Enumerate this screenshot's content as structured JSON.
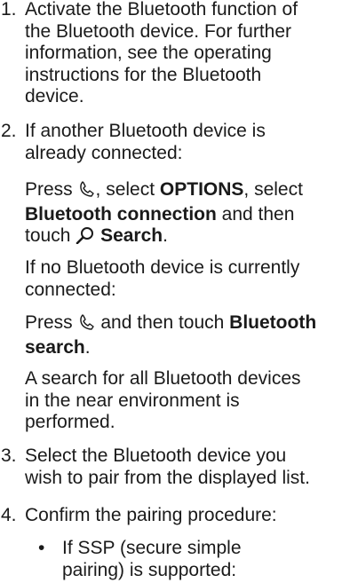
{
  "steps": [
    {
      "number": "1.",
      "lines": [
        "Activate the Bluetooth function of",
        "the Bluetooth device. For further",
        "information, see the operating",
        "instructions for the Bluetooth",
        "device."
      ]
    },
    {
      "number": "2.",
      "lines": [
        "If another Bluetooth device is",
        "already connected:"
      ]
    },
    {
      "number": "3.",
      "lines": [
        "Select the Bluetooth device you",
        "wish to pair from the displayed list."
      ]
    },
    {
      "number": "4.",
      "lines": [
        "Confirm the pairing procedure:"
      ]
    }
  ],
  "para_a": {
    "press": "Press",
    "select": ", select",
    "options": "OPTIONS",
    "select2": ", select",
    "bt_connection": "Bluetooth connection",
    "and_then": "and then",
    "touch": "touch",
    "search": "Search",
    "period": "."
  },
  "para_b": {
    "line1": "If no Bluetooth device is currently",
    "line2": "connected:"
  },
  "para_c": {
    "press": "Press",
    "and_then_touch": "and then touch",
    "bt": "Bluetooth",
    "search": "search",
    "period": "."
  },
  "para_d": {
    "line1": "A search for all Bluetooth devices",
    "line2": "in the near environment is",
    "line3": "performed."
  },
  "bullet": {
    "symbol": "•",
    "line1": "If SSP (secure simple",
    "line2": "pairing) is supported:"
  },
  "icons": {
    "phone": "phone-icon",
    "search": "search-icon"
  }
}
